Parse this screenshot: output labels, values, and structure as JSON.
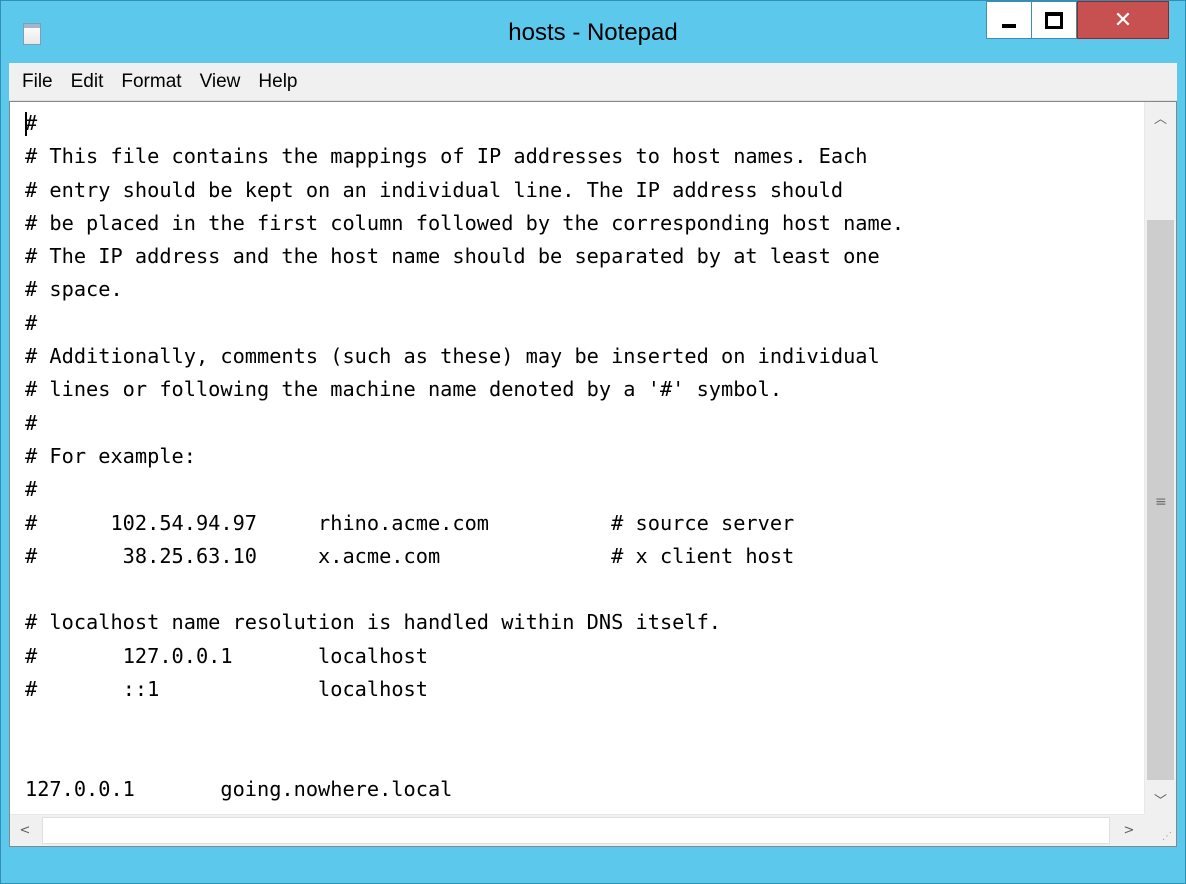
{
  "window": {
    "title": "hosts - Notepad",
    "icons": {
      "app": "notepad-icon",
      "minimize": "minimize-icon",
      "maximize": "maximize-icon",
      "close": "close-icon"
    },
    "colors": {
      "frame": "#5bc8ec",
      "close_button": "#c75050"
    }
  },
  "menu": {
    "items": [
      "File",
      "Edit",
      "Format",
      "View",
      "Help"
    ]
  },
  "editor": {
    "content": "#\n# This file contains the mappings of IP addresses to host names. Each\n# entry should be kept on an individual line. The IP address should\n# be placed in the first column followed by the corresponding host name.\n# The IP address and the host name should be separated by at least one\n# space.\n#\n# Additionally, comments (such as these) may be inserted on individual\n# lines or following the machine name denoted by a '#' symbol.\n#\n# For example:\n#\n#      102.54.94.97     rhino.acme.com          # source server\n#       38.25.63.10     x.acme.com              # x client host\n\n# localhost name resolution is handled within DNS itself.\n#\t127.0.0.1       localhost\n#\t::1             localhost\n\n\n127.0.0.1       going.nowhere.local"
  },
  "scrollbars": {
    "vertical": {
      "up_icon": "chevron-up-icon",
      "down_icon": "chevron-down-icon",
      "grip_icon": "grip-lines-icon"
    },
    "horizontal": {
      "left_icon": "chevron-left-icon",
      "right_icon": "chevron-right-icon"
    }
  }
}
